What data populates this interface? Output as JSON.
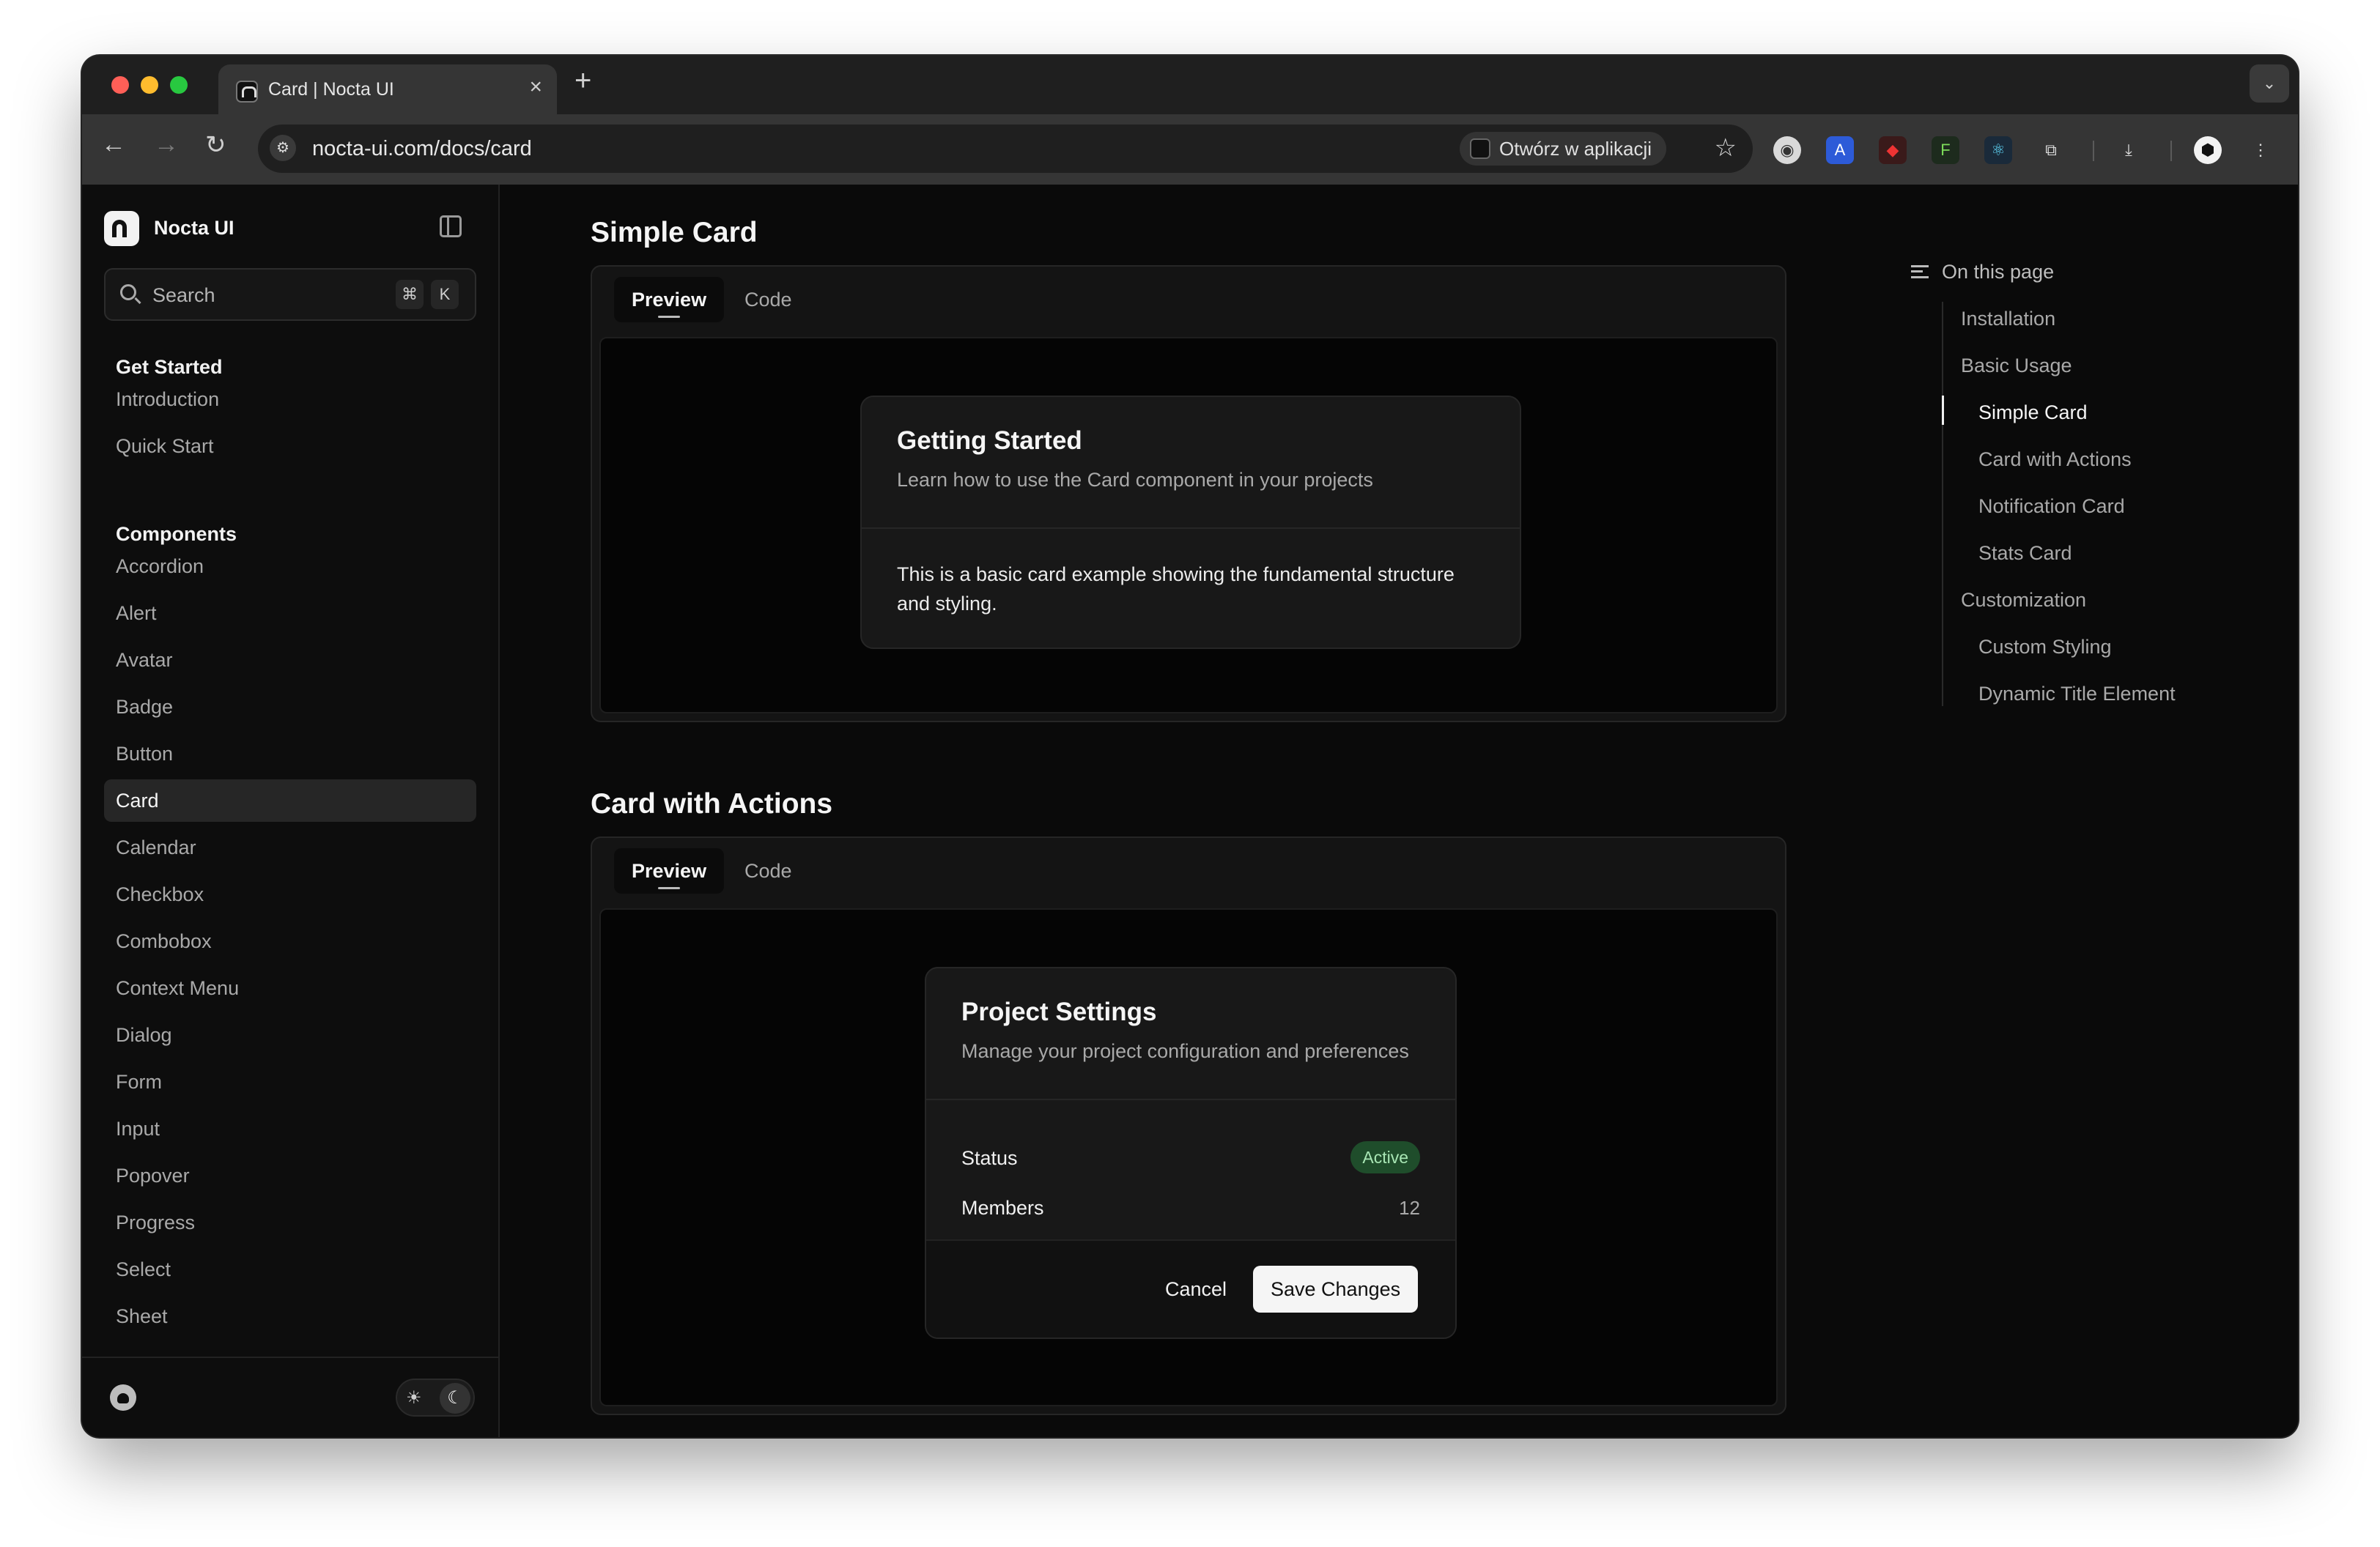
{
  "browser": {
    "tab_title": "Card | Nocta UI",
    "url": "nocta-ui.com/docs/card",
    "open_in_app": "Otwórz w aplikacji"
  },
  "sidebar": {
    "brand": "Nocta UI",
    "search_label": "Search",
    "shortcut_mod": "⌘",
    "shortcut_key": "K",
    "sections": [
      {
        "title": "Get Started",
        "items": [
          "Introduction",
          "Quick Start"
        ]
      },
      {
        "title": "Components",
        "items": [
          "Accordion",
          "Alert",
          "Avatar",
          "Badge",
          "Button",
          "Card",
          "Calendar",
          "Checkbox",
          "Combobox",
          "Context Menu",
          "Dialog",
          "Form",
          "Input",
          "Popover",
          "Progress",
          "Select",
          "Sheet"
        ]
      }
    ],
    "active_item": "Card"
  },
  "main": {
    "simple_card": {
      "heading": "Simple Card",
      "tab_preview": "Preview",
      "tab_code": "Code",
      "card_title": "Getting Started",
      "card_description": "Learn how to use the Card component in your projects",
      "card_body_line1": "This is a basic card example showing the fundamental structure",
      "card_body_line2": "and styling."
    },
    "card_actions": {
      "heading": "Card with Actions",
      "tab_preview": "Preview",
      "tab_code": "Code",
      "card_title": "Project Settings",
      "card_description": "Manage your project configuration and preferences",
      "status_label": "Status",
      "status_value": "Active",
      "members_label": "Members",
      "members_value": "12",
      "cancel_label": "Cancel",
      "save_label": "Save Changes"
    }
  },
  "toc": {
    "heading": "On this page",
    "items": [
      "Installation",
      "Basic Usage",
      "Simple Card",
      "Card with Actions",
      "Notification Card",
      "Stats Card",
      "Customization",
      "Custom Styling",
      "Dynamic Title Element"
    ],
    "active": "Simple Card"
  },
  "colors": {
    "background": "#0a0a0a",
    "sidebar": "#0d0d0d",
    "card": "#181818",
    "badge_bg": "#1f4d2b",
    "badge_text": "#a8e6b4"
  }
}
